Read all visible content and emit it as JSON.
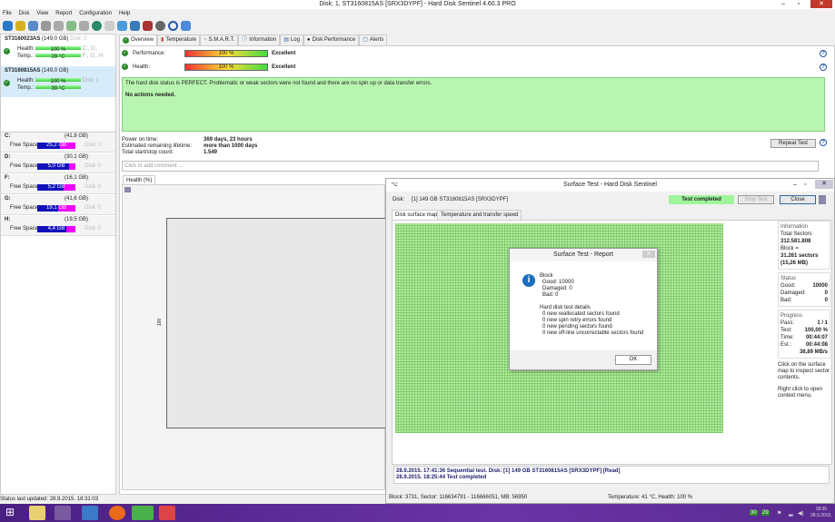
{
  "window": {
    "title": "Disk: 1, ST3160815AS [SRX3DYPF]  -  Hard Disk Sentinel 4.60.3 PRO",
    "min": "–",
    "max": "▫",
    "close": "✕"
  },
  "menu": [
    "File",
    "Disk",
    "View",
    "Report",
    "Configuration",
    "Help"
  ],
  "disks": [
    {
      "name": "ST3160023AS",
      "size": "(149,0 GB)",
      "disk": "Disk: 0",
      "health_label": "Health:",
      "health": "100 %",
      "temp_label": "Temp.:",
      "temp": "29 °C",
      "drives1": "C:, D:,",
      "drives2": "F:, G:, H:"
    },
    {
      "name": "ST3160815AS",
      "size": "(149,0 GB)",
      "disk": "Disk: 1",
      "health_label": "Health:",
      "health": "100 %",
      "temp_label": "Temp.:",
      "temp": "39 °C"
    }
  ],
  "partitions": [
    {
      "letter": "C:",
      "size": "(41,8 GB)",
      "label": "Free Space",
      "free": "25,2 GB",
      "fill": 60,
      "disk": "Disk: 0"
    },
    {
      "letter": "D:",
      "size": "(30,1 GB)",
      "label": "Free Space",
      "free": "5,0 GB",
      "fill": 83,
      "disk": "Disk: 0"
    },
    {
      "letter": "F:",
      "size": "(16,1 GB)",
      "label": "Free Space",
      "free": "5,2 GB",
      "fill": 68,
      "disk": "Disk: 0"
    },
    {
      "letter": "G:",
      "size": "(41,6 GB)",
      "label": "Free Space",
      "free": "19,1 GB",
      "fill": 54,
      "disk": "Disk: 0"
    },
    {
      "letter": "H:",
      "size": "(19,5 GB)",
      "label": "Free Space",
      "free": "4,4 GB",
      "fill": 77,
      "disk": "Disk: 0"
    }
  ],
  "tabs": [
    "Overview",
    "Temperature",
    "S.M.A.R.T.",
    "Information",
    "Log",
    "Disk Performance",
    "Alerts"
  ],
  "overview": {
    "performance_label": "Performance:",
    "performance": "100 %",
    "performance_rating": "Excellent",
    "health_label": "Health:",
    "health": "100 %",
    "health_rating": "Excellent",
    "status_text": "The hard disk status is PERFECT. Problematic or weak sectors were not found and there are no spin up or data transfer errors.",
    "actions": "No actions needed.",
    "power_on_label": "Power on time:",
    "power_on": "369 days, 23 hours",
    "lifetime_label": "Estimated remaining lifetime:",
    "lifetime": "more than 1000 days",
    "startstop_label": "Total start/stop count:",
    "startstop": "1.549",
    "repeat_test": "Repeat Test",
    "comment_placeholder": "Click to add comment ...",
    "chart_tab": "Health (%)",
    "chart_ylabel": "100"
  },
  "status_bar": "Status last updated: 28.9.2015. 18:31:03",
  "surface": {
    "title": "Surface Test - Hard Disk Sentinel",
    "disk_label": "Disk:",
    "disk": "[1] 149 GB  ST3160815AS [SRX3DYPF]",
    "status": "Test completed",
    "stop": "Stop Test",
    "close": "Close",
    "tabs": [
      "Disk surface map",
      "Temperature and transfer speed"
    ],
    "info_title": "Information",
    "total_label": "Total Sectors",
    "total": "312.581.808",
    "block_label": "Block =",
    "block_sectors": "31.261 sectors",
    "block_mb": "(15,26 MB)",
    "status_title": "Status",
    "good_label": "Good:",
    "good": "10000",
    "damaged_label": "Damaged:",
    "damaged": "0",
    "bad_label": "Bad:",
    "bad": "0",
    "progress_title": "Progress",
    "pass_label": "Pass:",
    "pass": "1 / 1",
    "test_label": "Test:",
    "test": "100,00 %",
    "time_label": "Time:",
    "time": "00:44:07",
    "est_label": "Est.:",
    "est": "00:44:08",
    "speed": "38,89 MB/s",
    "hint1": "Click on the surface map to inspect sector contents.",
    "hint2": "Right click to open context menu.",
    "log": [
      "28.9.2015.  17:41:36  Sequential test. Disk: [1] 149 GB  ST3160815AS [SRX3DYPF] [Read]",
      "28.9.2015.  18:25:44  Test completed"
    ],
    "footer_left": "Block: 3731, Sector: 116634791 - 116666051, MB: 56950",
    "footer_right": "Temperature: 41  °C,  Health: 100 %"
  },
  "report": {
    "title": "Surface Test - Report",
    "lines": [
      "Block",
      "Good: 10000",
      "Damaged: 0",
      "Bad: 0",
      "",
      "Hard disk test details",
      "0 new reallocated sectors found",
      "0 new spin retry errors found",
      "0 new pending sectors found",
      "0 new off-line uncorrectable sectors found"
    ],
    "ok": "OK"
  },
  "taskbar": {
    "temp1": "30",
    "temp2": "29",
    "time": "18:35",
    "date": "28.9.2015."
  }
}
